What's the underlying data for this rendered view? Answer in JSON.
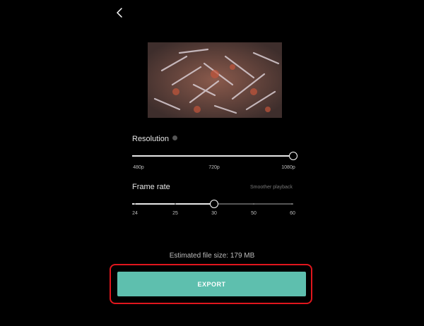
{
  "header": {
    "back_icon": "chevron-left-icon"
  },
  "preview": {
    "description": "video preview thumbnail"
  },
  "resolution": {
    "label": "Resolution",
    "info_icon": "info-dot-icon",
    "ticks": [
      "480p",
      "720p",
      "1080p"
    ],
    "selected": "1080p",
    "selected_fraction": 1.0
  },
  "frame_rate": {
    "label": "Frame rate",
    "hint": "Smoother playback",
    "ticks": [
      "24",
      "25",
      "30",
      "50",
      "60"
    ],
    "selected": "30",
    "selected_fraction": 0.5
  },
  "file_size": {
    "text": "Estimated file size: 179 MB"
  },
  "export": {
    "label": "EXPORT",
    "button_color": "#5ebfae",
    "highlight_color": "#e0161d"
  }
}
